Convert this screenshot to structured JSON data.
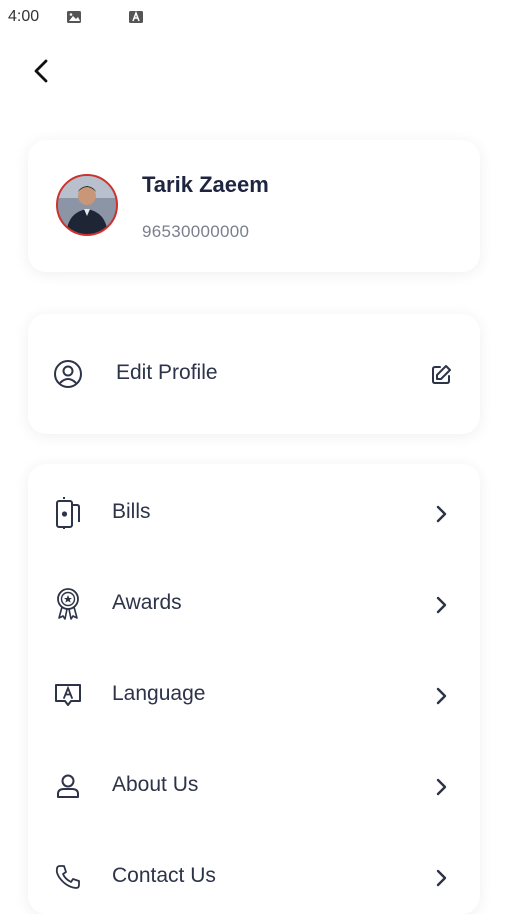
{
  "status_bar": {
    "time": "4:00",
    "icons": [
      "image-icon",
      "font-icon"
    ]
  },
  "nav": {
    "back_icon": "chevron-left-icon"
  },
  "profile": {
    "name": "Tarik Zaeem",
    "phone": "96530000000",
    "avatar_border_color": "#d0312d"
  },
  "edit_profile": {
    "label": "Edit Profile",
    "leading_icon": "user-circle-icon",
    "trailing_icon": "edit-icon"
  },
  "menu": {
    "items": [
      {
        "label": "Bills",
        "icon": "bills-icon"
      },
      {
        "label": "Awards",
        "icon": "award-icon"
      },
      {
        "label": "Language",
        "icon": "language-icon"
      },
      {
        "label": "About Us",
        "icon": "user-icon"
      },
      {
        "label": "Contact Us",
        "icon": "phone-icon"
      }
    ],
    "trailing_icon": "chevron-right-icon"
  }
}
